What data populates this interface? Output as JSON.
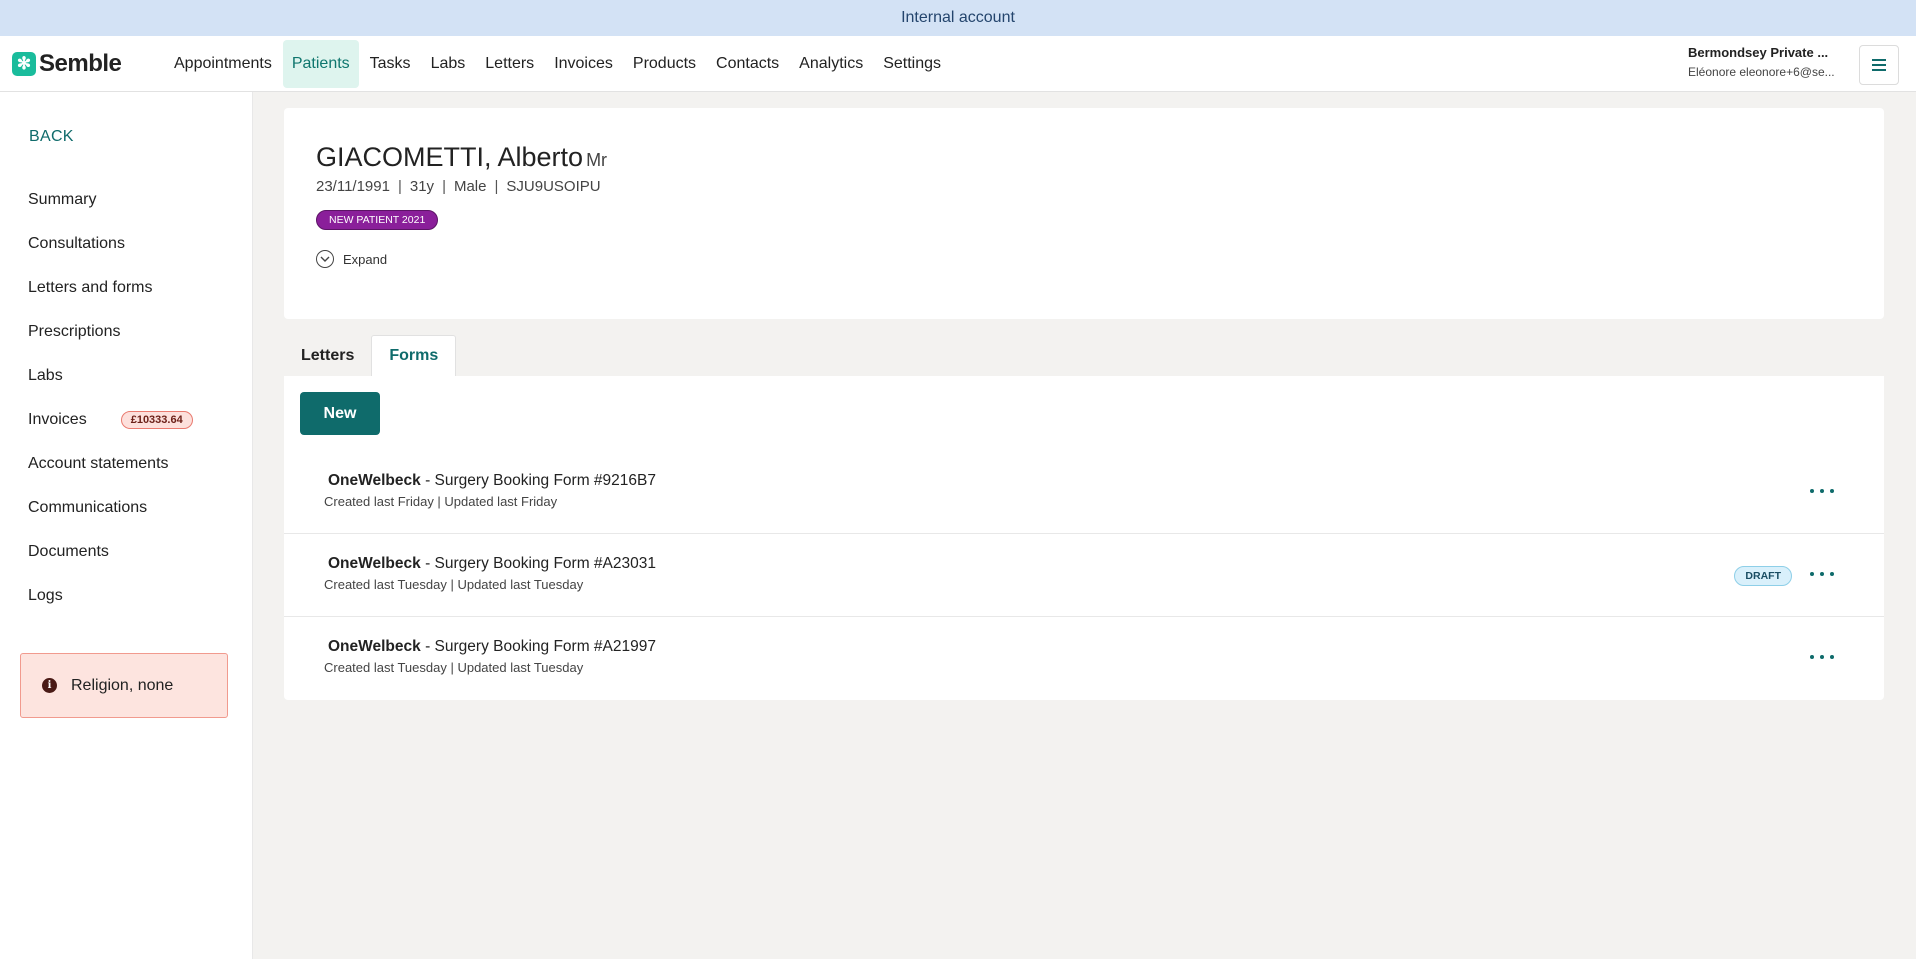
{
  "banner": {
    "text": "Internal account"
  },
  "topbar": {
    "brand": "Semble",
    "nav": [
      "Appointments",
      "Patients",
      "Tasks",
      "Labs",
      "Letters",
      "Invoices",
      "Products",
      "Contacts",
      "Analytics",
      "Settings"
    ],
    "active_nav": "Patients",
    "account_name": "Bermondsey Private ...",
    "account_user": "Eléonore eleonore+6@se..."
  },
  "sidebar": {
    "back": "BACK",
    "items": [
      "Summary",
      "Consultations",
      "Letters and forms",
      "Prescriptions",
      "Labs",
      "Invoices",
      "Account statements",
      "Communications",
      "Documents",
      "Logs"
    ],
    "invoice_badge": "£10333.64",
    "alert": "Religion, none"
  },
  "patient": {
    "name": "GIACOMETTI, Alberto",
    "title": "Mr",
    "dob": "23/11/1991",
    "age": "31y",
    "sex": "Male",
    "id": "SJU9USOIPU",
    "tag": "NEW PATIENT 2021",
    "expand": "Expand"
  },
  "tabs": {
    "letters": "Letters",
    "forms": "Forms",
    "active": "Forms"
  },
  "forms": {
    "new_label": "New",
    "rows": [
      {
        "org": "OneWelbeck",
        "title": " - Surgery Booking Form #9216B7",
        "meta": "Created last Friday | Updated last Friday",
        "status": ""
      },
      {
        "org": "OneWelbeck",
        "title": " - Surgery Booking Form #A23031",
        "meta": "Created last Tuesday | Updated last Tuesday",
        "status": "DRAFT"
      },
      {
        "org": "OneWelbeck",
        "title": " - Surgery Booking Form #A21997",
        "meta": "Created last Tuesday | Updated last Tuesday",
        "status": ""
      }
    ]
  },
  "colors": {
    "brand": "#1abc9c",
    "accent": "#0f6b6b",
    "tag": "#8a1f9a",
    "alert_bg": "#fde4df"
  }
}
